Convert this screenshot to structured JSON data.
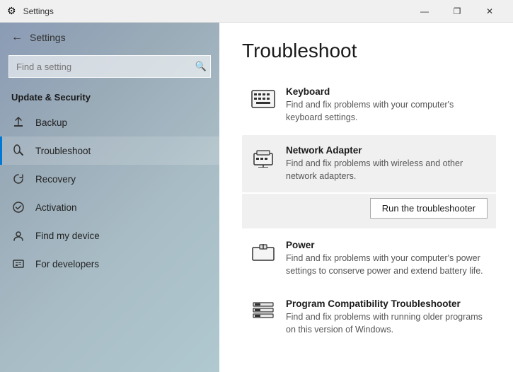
{
  "titleBar": {
    "title": "Settings",
    "controls": {
      "minimize": "—",
      "maximize": "❐",
      "close": "✕"
    }
  },
  "sidebar": {
    "backArrow": "←",
    "appTitle": "Settings",
    "search": {
      "placeholder": "Find a setting",
      "searchIcon": "🔍"
    },
    "sectionTitle": "Update & Security",
    "items": [
      {
        "id": "backup",
        "label": "Backup",
        "icon": "⬆"
      },
      {
        "id": "troubleshoot",
        "label": "Troubleshoot",
        "icon": "🔑",
        "active": true
      },
      {
        "id": "recovery",
        "label": "Recovery",
        "icon": "↺"
      },
      {
        "id": "activation",
        "label": "Activation",
        "icon": "✓"
      },
      {
        "id": "find-my-device",
        "label": "Find my device",
        "icon": "👤"
      },
      {
        "id": "for-developers",
        "label": "For developers",
        "icon": "⚙"
      }
    ]
  },
  "content": {
    "title": "Troubleshoot",
    "items": [
      {
        "id": "keyboard",
        "title": "Keyboard",
        "description": "Find and fix problems with your computer's keyboard settings.",
        "highlighted": false
      },
      {
        "id": "network-adapter",
        "title": "Network Adapter",
        "description": "Find and fix problems with wireless and other network adapters.",
        "highlighted": true
      },
      {
        "id": "power",
        "title": "Power",
        "description": "Find and fix problems with your computer's power settings to conserve power and extend battery life.",
        "highlighted": false
      },
      {
        "id": "program-compatibility",
        "title": "Program Compatibility Troubleshooter",
        "description": "Find and fix problems with running older programs on this version of Windows.",
        "highlighted": false
      }
    ],
    "runButton": "Run the troubleshooter"
  }
}
